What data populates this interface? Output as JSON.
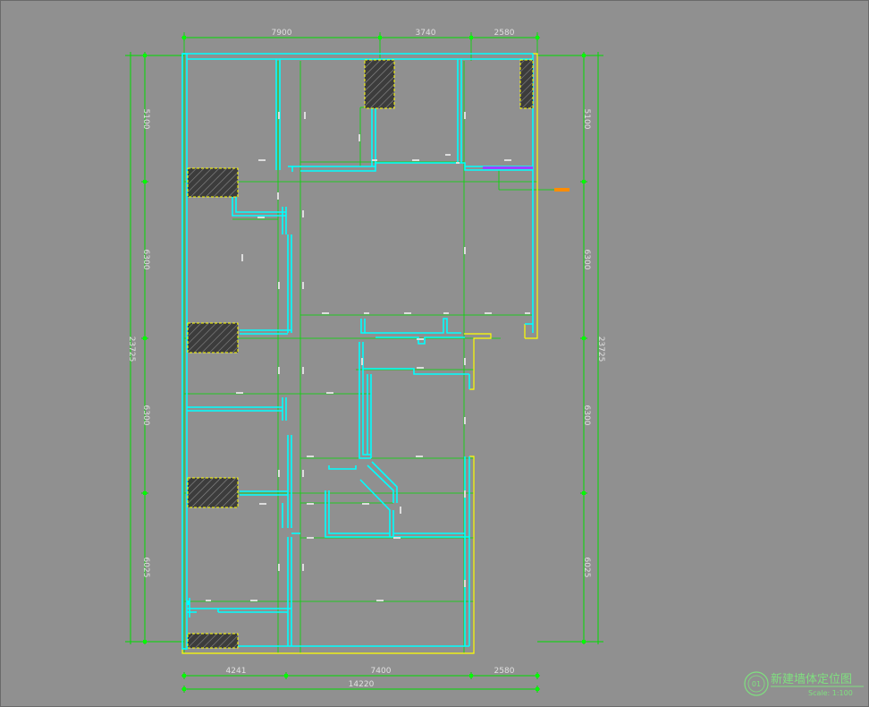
{
  "top_dims": [
    "7900",
    "3740",
    "2580"
  ],
  "bottom_dims": [
    "4241",
    "7400",
    "2580"
  ],
  "bottom_total": "14220",
  "left_dims": [
    "5100",
    "6300",
    "6300",
    "6025"
  ],
  "left_total": "23725",
  "right_dims": [
    "5100",
    "6300",
    "6300",
    "6025"
  ],
  "right_total": "23725",
  "title": {
    "badge": "01",
    "main": "新建墙体定位图",
    "scale": "Scale: 1:100"
  },
  "colors": {
    "background": "#909090",
    "dimension_line": "#00ff00",
    "wall": "#00ffff",
    "outline": "#ffff00",
    "column_hatch": "#404040",
    "accent_orange": "#ff8c00",
    "accent_purple": "#a040ff"
  }
}
